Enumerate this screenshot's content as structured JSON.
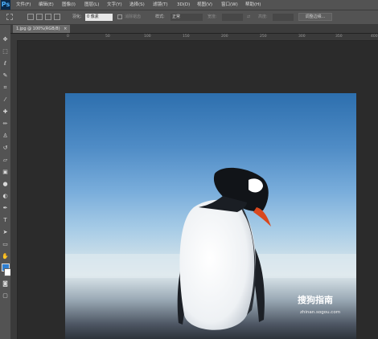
{
  "app": {
    "logo": "Ps"
  },
  "menu": [
    "文件(F)",
    "编辑(E)",
    "图像(I)",
    "图层(L)",
    "文字(Y)",
    "选择(S)",
    "滤镜(T)",
    "3D(D)",
    "视图(V)",
    "窗口(W)",
    "帮助(H)"
  ],
  "options": {
    "feather_label": "羽化:",
    "feather_value": "0 像素",
    "antialias_label": "消除锯齿",
    "style_label": "样式:",
    "style_value": "正常",
    "width_label": "宽度:",
    "height_label": "高度:",
    "refine_edge_button": "调整边缘..."
  },
  "document": {
    "tab_label": "1.jpg @ 100%(RGB/8)",
    "close_icon": "×"
  },
  "ruler_ticks": [
    "0",
    "50",
    "100",
    "150",
    "200",
    "250",
    "300",
    "350",
    "400"
  ],
  "watermark": {
    "line1": "搜狗指南",
    "line2": "zhinan.sogou.com"
  },
  "colors": {
    "foreground": "#2f7fd0",
    "background": "#ffffff"
  }
}
